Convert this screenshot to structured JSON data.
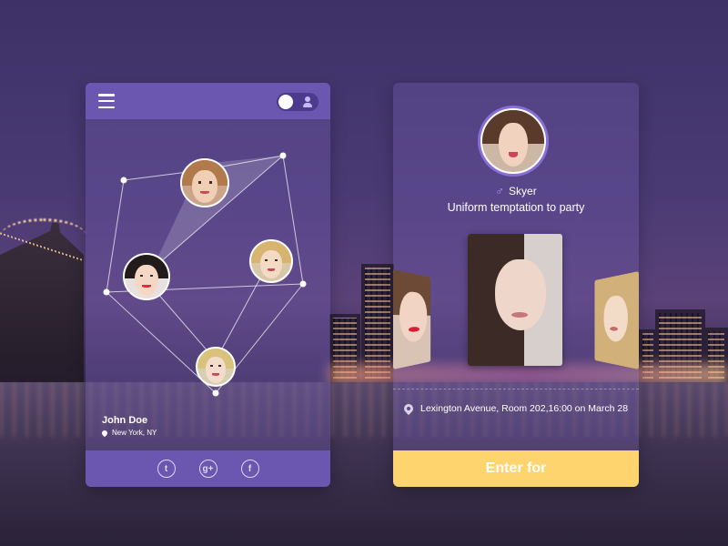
{
  "profile_card": {
    "user_name": "John Doe",
    "user_location": "New York, NY",
    "social": {
      "twitter_glyph": "t",
      "google_plus_glyph": "g+",
      "facebook_glyph": "f"
    },
    "icons": [
      "hamburger-menu-icon",
      "user-icon",
      "location-pin-icon",
      "twitter-icon",
      "google-plus-icon",
      "facebook-icon"
    ]
  },
  "event_card": {
    "host_name": "Skyer",
    "gender_symbol": "♂",
    "event_title": "Uniform temptation to party",
    "address": "Lexington Avenue, Room 202,16:00 on March 28",
    "enter_label": "Enter for",
    "icons": [
      "male-gender-icon",
      "location-pin-icon"
    ]
  },
  "colors": {
    "accent_purple": "#6b56b0",
    "button_yellow": "#fed46f",
    "avatar_ring": "#8a6ed8"
  }
}
